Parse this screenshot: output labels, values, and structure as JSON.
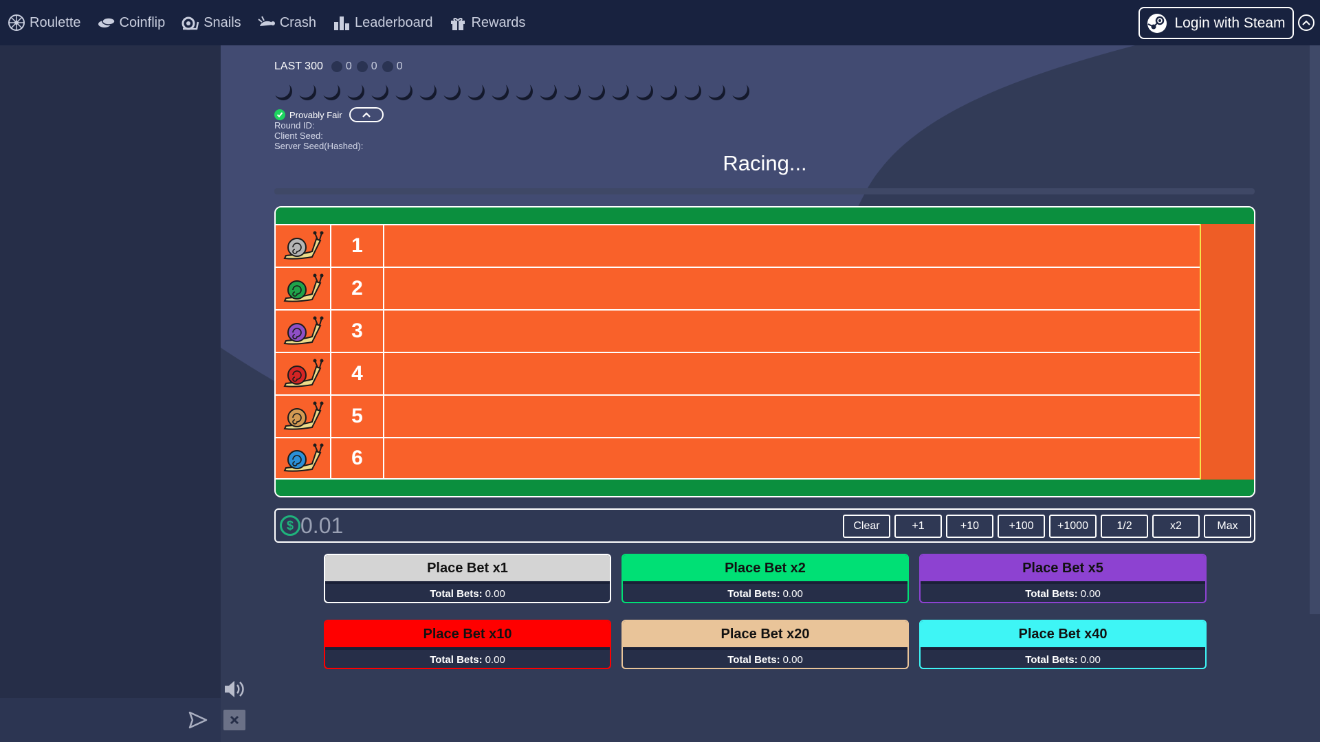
{
  "nav": {
    "items": [
      {
        "label": "Roulette",
        "icon": "roulette-wheel-icon"
      },
      {
        "label": "Coinflip",
        "icon": "coins-icon"
      },
      {
        "label": "Snails",
        "icon": "snail-icon"
      },
      {
        "label": "Crash",
        "icon": "crash-turtle-icon"
      },
      {
        "label": "Leaderboard",
        "icon": "bar-chart-icon"
      },
      {
        "label": "Rewards",
        "icon": "gift-icon"
      }
    ],
    "login_label": "Login with Steam"
  },
  "stats": {
    "label": "LAST 300",
    "values": [
      "0",
      "0",
      "0"
    ]
  },
  "history_count": 20,
  "provably_fair": {
    "label": "Provably Fair",
    "round_id_label": "Round ID:",
    "client_seed_label": "Client Seed:",
    "server_seed_label": "Server Seed(Hashed):"
  },
  "status": "Racing...",
  "lanes": [
    {
      "number": "1",
      "color": "#b5b5b5"
    },
    {
      "number": "2",
      "color": "#1fa34a"
    },
    {
      "number": "3",
      "color": "#8e4fc6"
    },
    {
      "number": "4",
      "color": "#d42424"
    },
    {
      "number": "5",
      "color": "#d39a52"
    },
    {
      "number": "6",
      "color": "#2b8fd8"
    }
  ],
  "amount": {
    "currency_symbol": "$",
    "value": "0.01",
    "buttons": [
      "Clear",
      "+1",
      "+10",
      "+100",
      "+1000",
      "1/2",
      "x2",
      "Max"
    ]
  },
  "bets": [
    {
      "label": "Place Bet x1",
      "color": "#d4d4d4",
      "total_label": "Total Bets:",
      "total": "0.00"
    },
    {
      "label": "Place Bet x2",
      "color": "#00e075",
      "total_label": "Total Bets:",
      "total": "0.00"
    },
    {
      "label": "Place Bet x5",
      "color": "#8d42d1",
      "total_label": "Total Bets:",
      "total": "0.00"
    },
    {
      "label": "Place Bet x10",
      "color": "#ff0000",
      "total_label": "Total Bets:",
      "total": "0.00"
    },
    {
      "label": "Place Bet x20",
      "color": "#e9c499",
      "total_label": "Total Bets:",
      "total": "0.00"
    },
    {
      "label": "Place Bet x40",
      "color": "#3ef5f5",
      "total_label": "Total Bets:",
      "total": "0.00"
    }
  ],
  "colors": {
    "topbar": "#18223f",
    "track_green": "#0b8f3e",
    "track_orange": "#f9612a"
  }
}
